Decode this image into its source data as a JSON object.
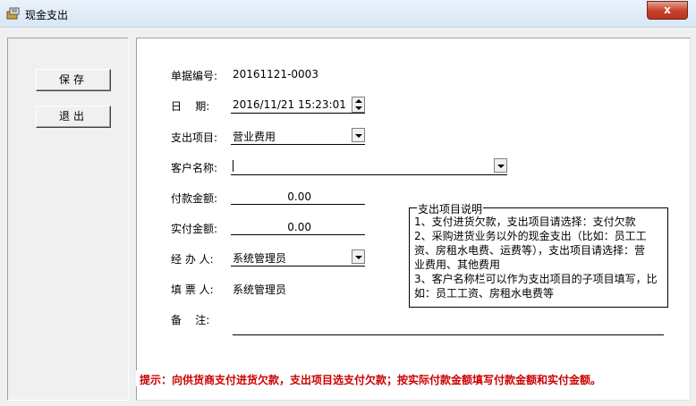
{
  "window": {
    "title": "现金支出",
    "close_label": "x"
  },
  "actions": {
    "save_label": "保存",
    "exit_label": "退出"
  },
  "form": {
    "doc_no": {
      "label": "单据编号:",
      "value": "20161121-0003"
    },
    "date": {
      "label": "日    期:",
      "value": "2016/11/21 15:23:01"
    },
    "expense_item": {
      "label": "支出项目:",
      "value": "营业费用"
    },
    "customer": {
      "label": "客户名称:",
      "value": ""
    },
    "payment": {
      "label": "付款金额:",
      "value": "0.00"
    },
    "actual": {
      "label": "实付金额:",
      "value": "0.00"
    },
    "handler": {
      "label": "经 办 人:",
      "value": "系统管理员"
    },
    "filler": {
      "label": "填 票 人:",
      "value": "系统管理员"
    },
    "remark": {
      "label": "备    注:",
      "value": ""
    }
  },
  "notes": {
    "title": "支出项目说明",
    "lines": [
      "1、支付进货欠款，支出项目请选择：支付欠款",
      "2、采购进货业务以外的现金支出（比如：员工工",
      "资、房租水电费、运费等），支出项目请选择：营",
      "业费用、其他费用",
      "3、客户名称栏可以作为支出项目的子项目填写，比",
      "如：员工工资、房租水电费等"
    ]
  },
  "hint": "提示：向供货商支付进货欠款，支出项目选支付欠款；按实际付款金额填写付款金额和实付金额。"
}
